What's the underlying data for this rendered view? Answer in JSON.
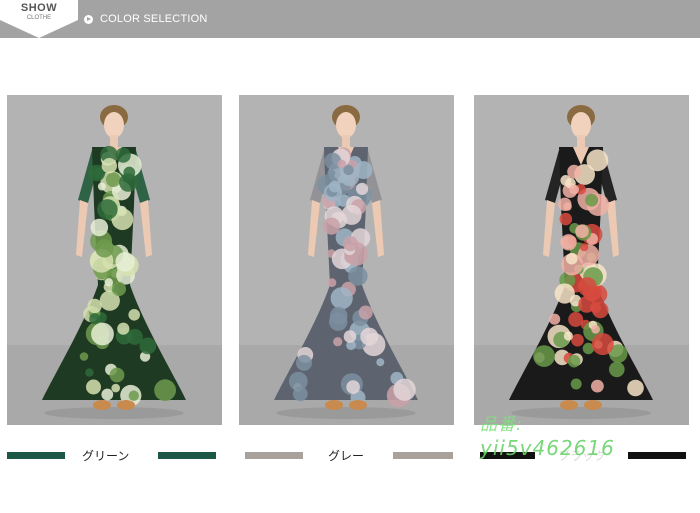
{
  "header": {
    "badge_title": "SHOW",
    "badge_sub": "CLOTHE",
    "section_title": "COLOR SELECTION"
  },
  "variants": [
    {
      "label": "グリーン",
      "swatch_color": "#1d5747",
      "sleeve_color": "#1f5a3a",
      "dress_base": "#1e3a22",
      "flower_colors": [
        "#d6e0b0",
        "#6f9a4e",
        "#2f6b3a",
        "#e8eed6"
      ]
    },
    {
      "label": "グレー",
      "swatch_color": "#a8a19c",
      "sleeve_color": "#8e8e94",
      "dress_base": "#5d6470",
      "flower_colors": [
        "#c9a1a8",
        "#9fb5c6",
        "#e3d6d8",
        "#7b8fa0"
      ]
    },
    {
      "label": "ブラック",
      "swatch_color": "#111111",
      "sleeve_color": "#141414",
      "dress_base": "#1a1a1a",
      "flower_colors": [
        "#d84a3e",
        "#f2b2a6",
        "#f7e4c8",
        "#6a9a4a"
      ]
    }
  ],
  "watermark": {
    "line1": "品番:",
    "line2": "yii5v462616"
  }
}
